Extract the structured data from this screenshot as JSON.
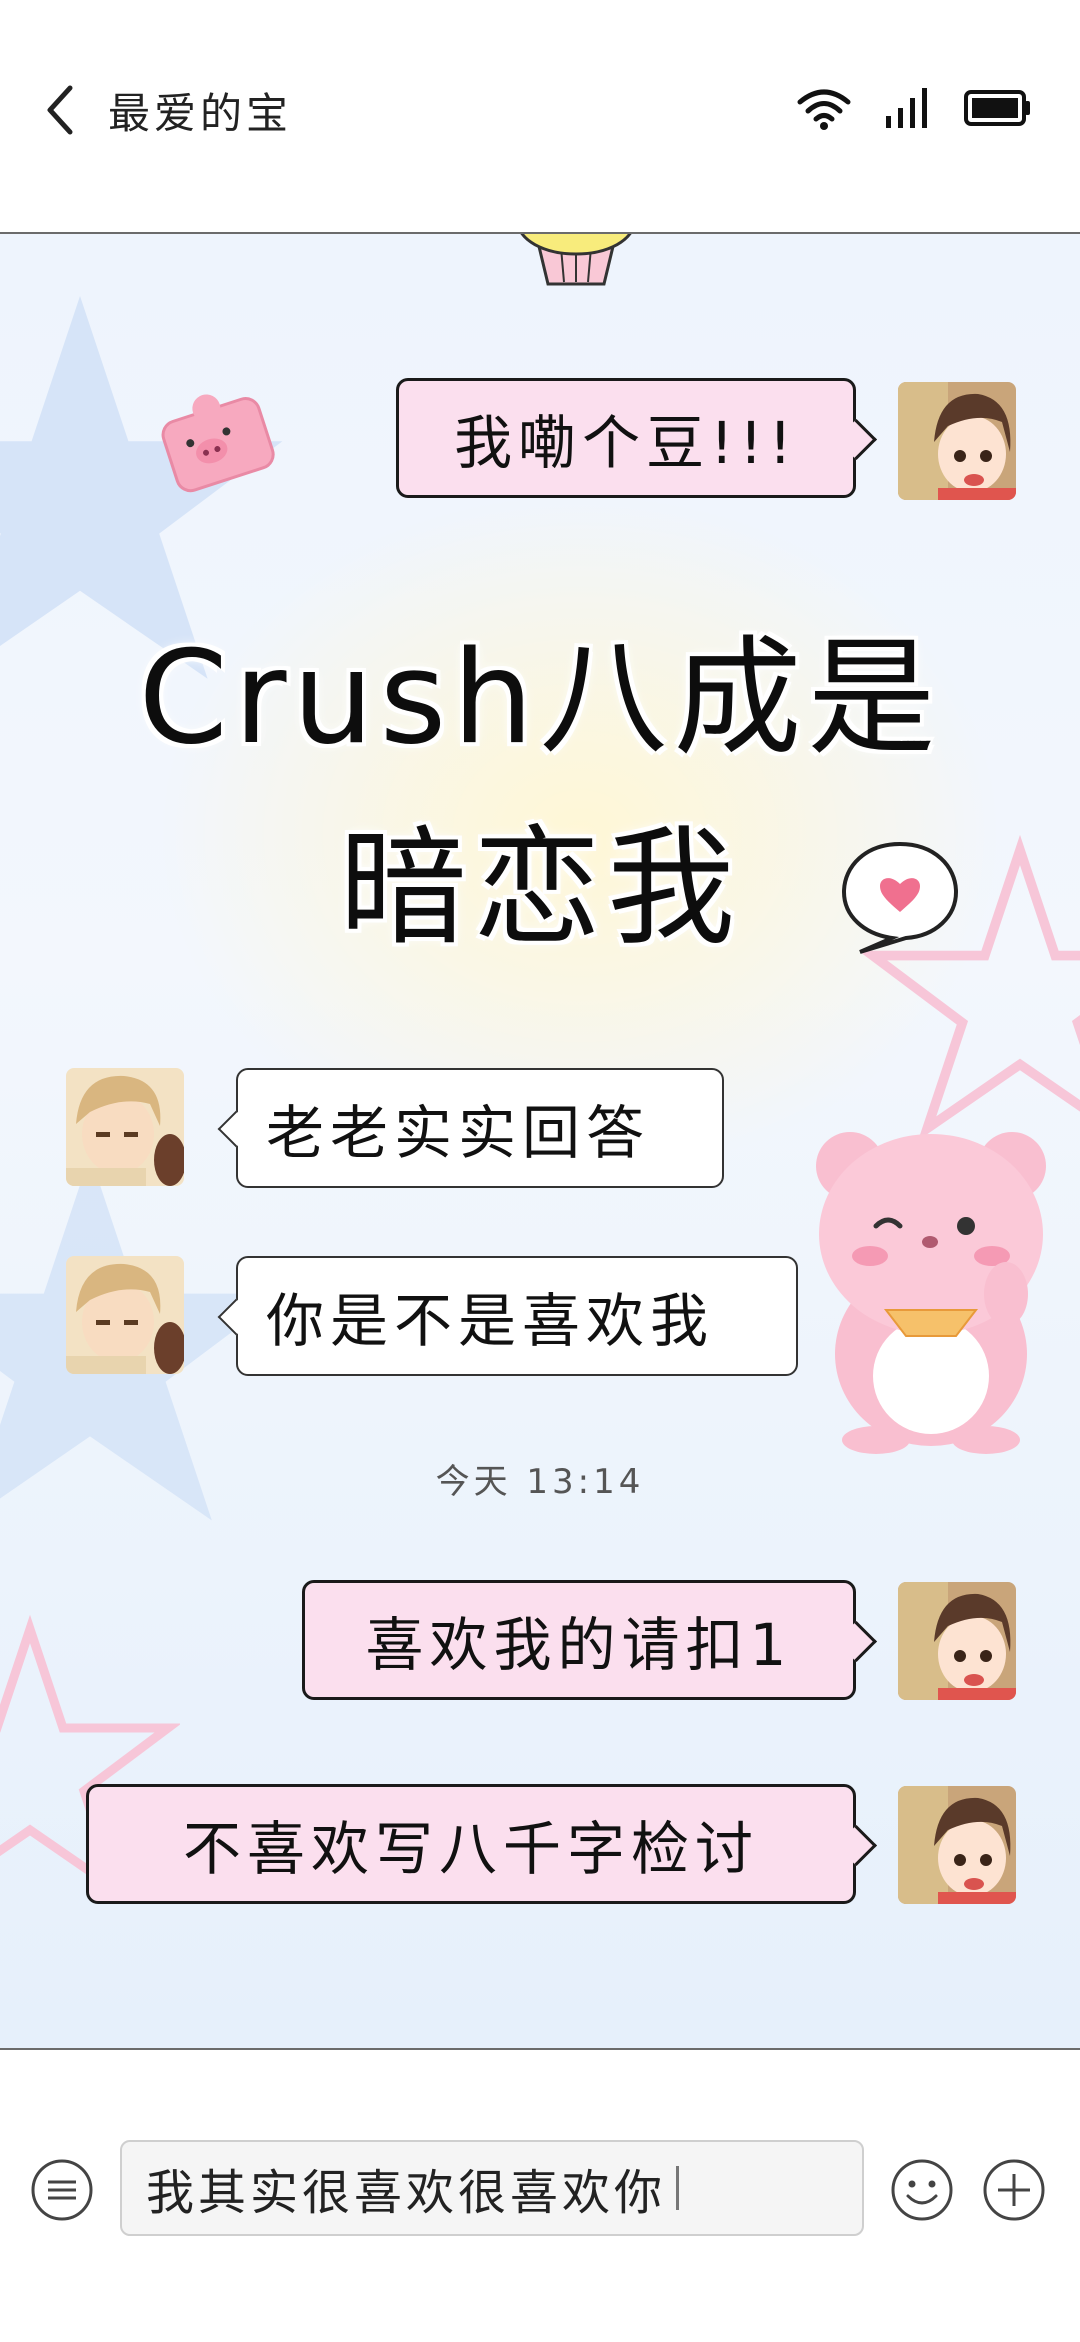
{
  "header": {
    "title": "最爱的宝",
    "back_icon": "chevron-left-icon",
    "status_icons": [
      "wifi-icon",
      "signal-icon",
      "battery-icon"
    ]
  },
  "messages": [
    {
      "side": "right",
      "text": "我嘞个豆!!!"
    },
    {
      "side": "left",
      "text": "老老实实回答"
    },
    {
      "side": "left",
      "text": "你是不是喜欢我"
    },
    {
      "side": "right",
      "text": "喜欢我的请扣1"
    },
    {
      "side": "right",
      "text": "不喜欢写八千字检讨"
    }
  ],
  "headline": {
    "line1": "Crush八成是",
    "line2": "暗恋我"
  },
  "timestamp": "今天 13:14",
  "composer": {
    "text": "我其实很喜欢很喜欢你",
    "icons": [
      "menu-icon",
      "emoji-icon",
      "add-icon"
    ]
  },
  "colors": {
    "bubble_pink": "#fbdfee",
    "bubble_white": "#ffffff",
    "background_blue": "#eef4fd",
    "accent_pink": "#f5a9c6"
  }
}
